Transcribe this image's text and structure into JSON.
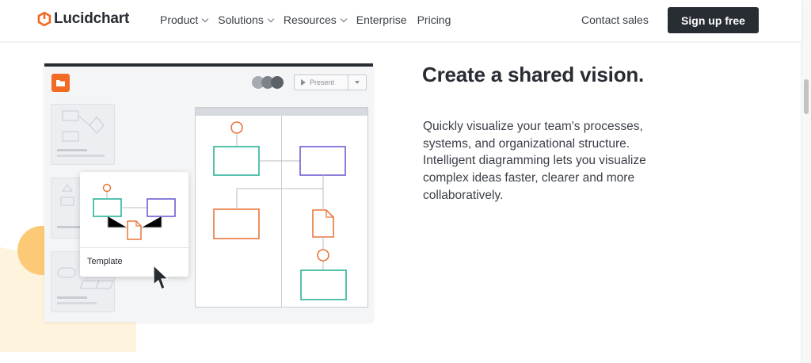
{
  "header": {
    "logo_text": "Lucidchart",
    "nav": [
      {
        "label": "Product",
        "has_dropdown": true
      },
      {
        "label": "Solutions",
        "has_dropdown": true
      },
      {
        "label": "Resources",
        "has_dropdown": true
      },
      {
        "label": "Enterprise",
        "has_dropdown": false
      },
      {
        "label": "Pricing",
        "has_dropdown": false
      }
    ],
    "contact_label": "Contact sales",
    "signup_label": "Sign up free"
  },
  "feature": {
    "headline": "Create a shared vision.",
    "body": "Quickly visualize your team's processes, systems, and organizational structure. Intelligent diagramming lets you visualize complex ideas faster, clearer and more collaboratively."
  },
  "mockup": {
    "present_label": "Present",
    "template_label": "Template"
  },
  "colors": {
    "brand_orange": "#f26b24",
    "dark": "#282c33",
    "teal": "#2bb39a",
    "purple": "#6a5fd1",
    "orange_shape": "#e8773c",
    "deco_yellow": "#fcc977",
    "deco_cream": "#fef3dd"
  },
  "icons": [
    "lucidchart-logo-icon",
    "chevron-down-icon",
    "folder-icon",
    "play-icon",
    "dropdown-arrow-icon",
    "cursor-arrow-icon",
    "document-icon"
  ]
}
